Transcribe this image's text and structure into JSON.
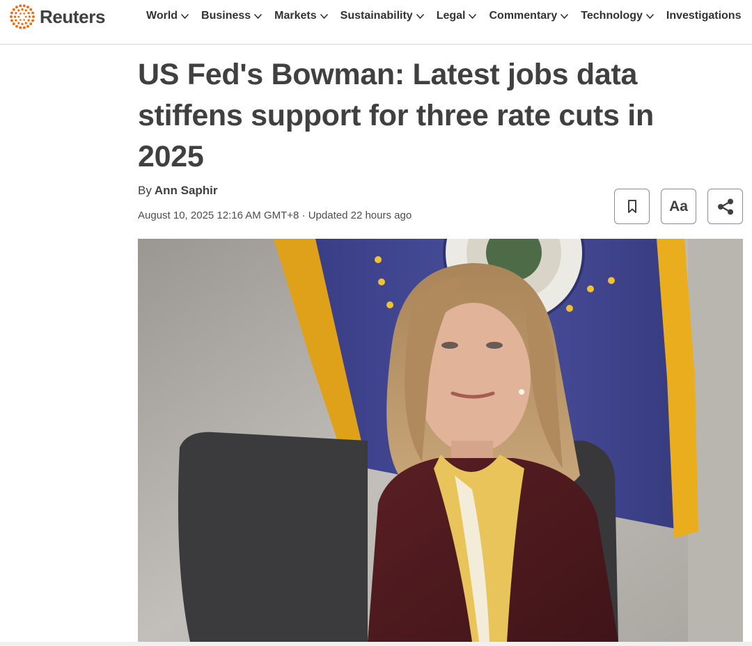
{
  "brand": {
    "name": "Reuters",
    "accent": "#fa6400"
  },
  "nav": {
    "items": [
      {
        "label": "World",
        "has_dropdown": true
      },
      {
        "label": "Business",
        "has_dropdown": true
      },
      {
        "label": "Markets",
        "has_dropdown": true
      },
      {
        "label": "Sustainability",
        "has_dropdown": true
      },
      {
        "label": "Legal",
        "has_dropdown": true
      },
      {
        "label": "Commentary",
        "has_dropdown": true
      },
      {
        "label": "Technology",
        "has_dropdown": true
      },
      {
        "label": "Investigations",
        "has_dropdown": false
      }
    ]
  },
  "article": {
    "headline": "US Fed's Bowman: Latest jobs data stiffens support for three rate cuts in 2025",
    "byline_prefix": "By",
    "author": "Ann Saphir",
    "dateline": "August 10, 2025 12:16 AM GMT+8 · Updated 22 hours ago"
  },
  "tools": {
    "font_size_label": "Aa",
    "icons": [
      "bookmark-icon",
      "font-size-icon",
      "share-icon"
    ]
  }
}
